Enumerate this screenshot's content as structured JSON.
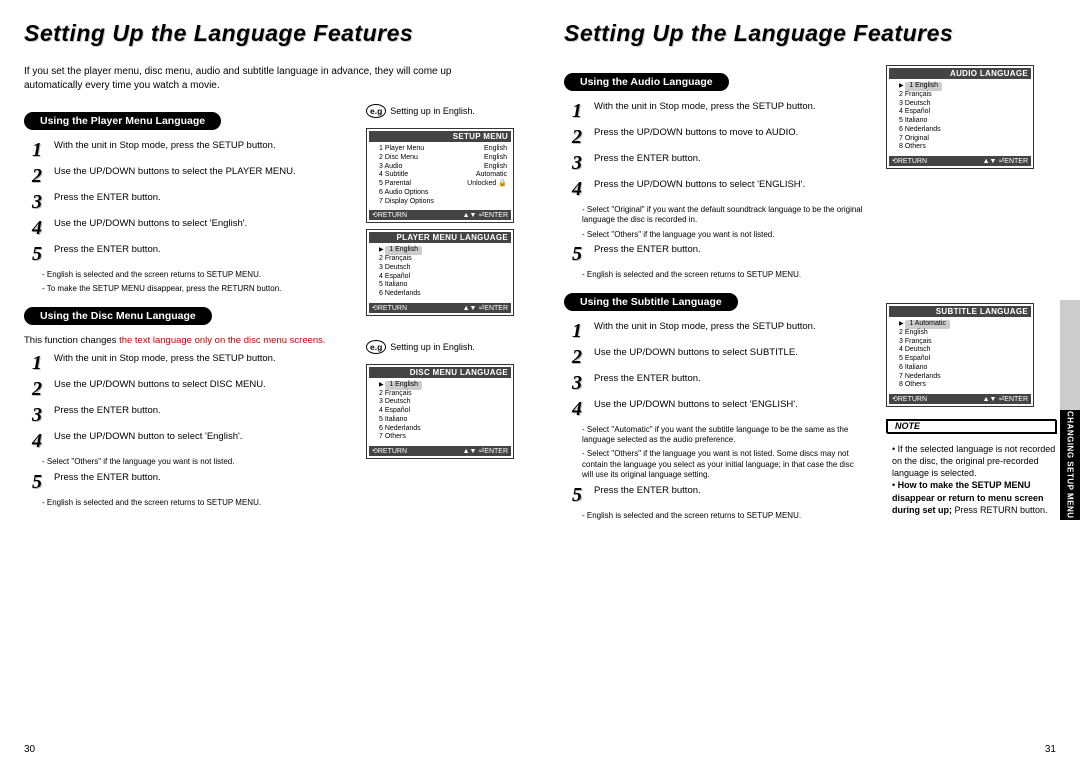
{
  "page_left": {
    "number": "30",
    "title": "Setting Up the Language Features",
    "intro": "If you set the player menu, disc menu, audio and subtitle language in advance, they will come up automatically every time you watch a movie.",
    "section_player": {
      "pill": "Using the Player Menu Language",
      "steps": [
        "With the unit in Stop mode, press the SETUP button.",
        "Use the UP/DOWN buttons to select the PLAYER MENU.",
        "Press the ENTER button.",
        "Use the UP/DOWN buttons to select 'English'.",
        "Press the ENTER button."
      ],
      "notes": [
        "English is selected and the screen returns to SETUP MENU.",
        "To make the SETUP MENU disappear, press the RETURN button."
      ]
    },
    "section_disc": {
      "pill": "Using the Disc Menu Language",
      "lead": "This function changes",
      "lead_red": "the text language only on the disc menu screens.",
      "steps": [
        "With the unit in Stop mode, press the SETUP button.",
        "Use the UP/DOWN buttons to select DISC MENU.",
        "Press the ENTER button.",
        "Use the UP/DOWN button to select 'English'."
      ],
      "note4": "Select \"Others\" if the language you want is not listed.",
      "step5": "Press the ENTER button.",
      "note5": "English is selected and the screen returns to SETUP MENU."
    },
    "eg": {
      "badge": "e.g",
      "text": "Setting up in English."
    },
    "osd_setup": {
      "title": "SETUP MENU",
      "rows": [
        [
          "1 Player Menu",
          "English"
        ],
        [
          "2 Disc Menu",
          "English"
        ],
        [
          "3 Audio",
          "English"
        ],
        [
          "4 Subtitle",
          "Automatic"
        ],
        [
          "5 Parental",
          "Unlocked"
        ],
        [
          "6 Audio Options",
          ""
        ],
        [
          "7 Display Options",
          ""
        ]
      ],
      "foot_l": "⟲RETURN",
      "foot_r": "▲▼ ⏎ENTER"
    },
    "osd_player": {
      "title": "PLAYER MENU LANGUAGE",
      "rows": [
        "1 English",
        "2 Français",
        "3 Deutsch",
        "4 Español",
        "5 Italiano",
        "6 Nederlands"
      ],
      "foot_l": "⟲RETURN",
      "foot_r": "▲▼ ⏎ENTER"
    },
    "osd_disc": {
      "title": "DISC MENU LANGUAGE",
      "rows": [
        "1 English",
        "2 Français",
        "3 Deutsch",
        "4 Español",
        "5 Italiano",
        "6 Nederlands",
        "7 Others"
      ],
      "foot_l": "⟲RETURN",
      "foot_r": "▲▼ ⏎ENTER"
    }
  },
  "page_right": {
    "number": "31",
    "title": "Setting Up the Language Features",
    "sidetab": "CHANGING SETUP MENU",
    "section_audio": {
      "pill": "Using the Audio Language",
      "steps": [
        "With the unit in Stop mode, press the SETUP button.",
        "Press the UP/DOWN buttons to move to AUDIO.",
        "Press the ENTER button.",
        "Press the UP/DOWN buttons to select 'ENGLISH'."
      ],
      "notes4": [
        "Select \"Original\" if you want the default soundtrack language to be the original language the disc is recorded in.",
        "Select \"Others\" if the language you want is not listed."
      ],
      "step5": "Press the ENTER button.",
      "note5": "English is selected and the screen returns to SETUP MENU."
    },
    "section_subtitle": {
      "pill": "Using the Subtitle Language",
      "steps": [
        "With the unit in Stop mode, press the SETUP button.",
        "Use the UP/DOWN buttons to select SUBTITLE.",
        "Press the ENTER button.",
        "Use the UP/DOWN buttons to select 'ENGLISH'."
      ],
      "notes4": [
        "Select \"Automatic\" if you want the subtitle language to be the same as the language selected as the audio preference.",
        "Select \"Others\" if the language you want is not listed. Some discs may not contain the language you select as your initial language; in that case the disc will use its original language setting."
      ],
      "step5": "Press the ENTER button.",
      "note5": "English is selected and the screen returns to SETUP MENU."
    },
    "osd_audio": {
      "title": "AUDIO LANGUAGE",
      "rows": [
        "1 English",
        "2 Français",
        "3 Deutsch",
        "4 Español",
        "5 Italiano",
        "6 Nederlands",
        "7 Original",
        "8 Others"
      ],
      "foot_l": "⟲RETURN",
      "foot_r": "▲▼ ⏎ENTER"
    },
    "osd_subtitle": {
      "title": "SUBTITLE LANGUAGE",
      "rows": [
        "1 Automatic",
        "2 English",
        "3 Français",
        "4 Deutsch",
        "5 Español",
        "6 Italiano",
        "7 Nederlands",
        "8 Others"
      ],
      "foot_l": "⟲RETURN",
      "foot_r": "▲▼ ⏎ENTER"
    },
    "footnote": {
      "label": "NOTE",
      "bullets": [
        "If the selected language is not recorded on the disc, the original pre-recorded language is selected."
      ],
      "howto_label": "How to make the SETUP MENU disappear or return to menu screen during set up;",
      "howto_tail": " Press RETURN button."
    }
  }
}
